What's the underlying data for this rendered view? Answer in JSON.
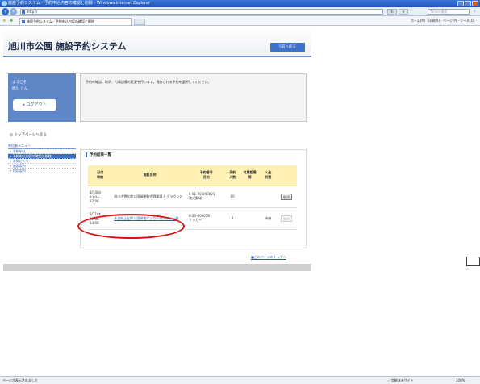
{
  "window": {
    "title": "施設予約システム／予約申込内容の確認と削除 - Windows Internet Explorer",
    "address": "http://",
    "search_placeholder": "Yahoo!検索",
    "tab_label": "施設予約システム／予約申込内容の確認と削除",
    "command_bar": "ホーム(M) · 印刷(R) · ページ(P) · ツール(O) ·",
    "status_left": "ページが表示されました",
    "status_zone": "信頼済みサイト",
    "status_zoom": "100%"
  },
  "app": {
    "title": "旭川市公園 施設予約システム",
    "back_button": "5前へ戻る"
  },
  "user_panel": {
    "welcome": "ようこそ",
    "username": "旭川 さん",
    "logout_button": "▸ ログアウト"
  },
  "message": "予約の確認、取消、付属設備の変更を行います。操作される予約を選択してください。",
  "sidebar": {
    "top_link": "トップページへ戻る",
    "menu_title": "利用者メニュー",
    "items": [
      {
        "label": "» 予約申込"
      },
      {
        "label": "» 予約申込内容の確認と削除"
      },
      {
        "label": "» お気に入り"
      },
      {
        "label": "» 施設案内"
      },
      {
        "label": "» 利用案内"
      }
    ]
  },
  "reservation_list": {
    "heading": "予約結果一覧",
    "columns": {
      "datetime": "日付\n時間",
      "facility": "施設名称",
      "number_purpose": "予約番号\n目的",
      "persons": "予約\n人数",
      "equipment": "付属設備\n等",
      "payment": "入金\n状態"
    },
    "rows": [
      {
        "date": "8/10(水)",
        "time": "9:00~\n12:00",
        "facility": "旭川大雪左岸公園緑地軟式野球場 A グラウンド",
        "number": "8-01-20-000023",
        "purpose": "軟式野球",
        "persons": "60",
        "equipment": "",
        "payment": "",
        "action": "取消",
        "facility_is_link": false,
        "action_disabled": false
      },
      {
        "date": "8/11(木)",
        "time": "12:00~\n14:00",
        "facility": "永里緑上左岸公園緑地サッカー場ラグビー場",
        "number": "8-20-000058",
        "purpose": "サッカー",
        "persons": "8",
        "equipment": "",
        "payment": "未納",
        "action": "取消",
        "facility_is_link": true,
        "action_disabled": true
      }
    ]
  },
  "page_top_link": "■このページのトップへ",
  "colors": {
    "accent": "#3a6ebd",
    "header_row": "#fff1b3",
    "highlight": "#e01010"
  }
}
